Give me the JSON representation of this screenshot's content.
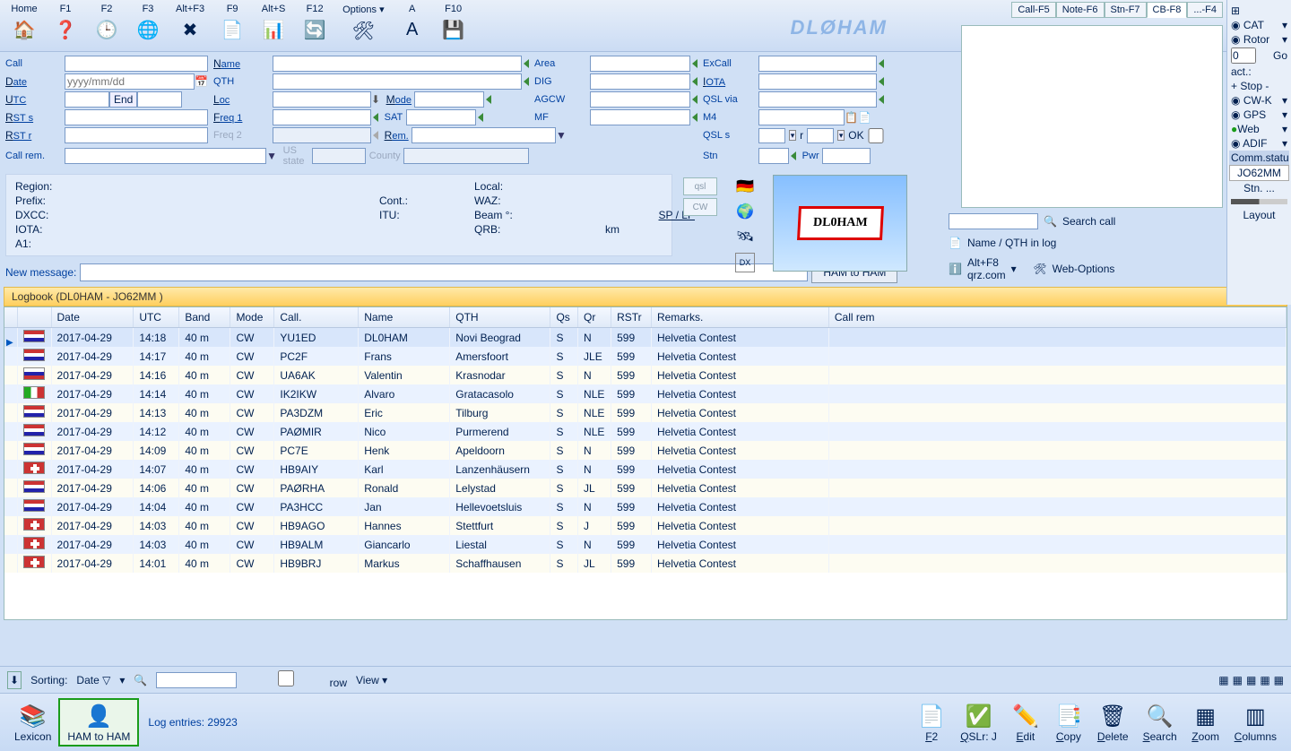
{
  "toolbar": {
    "items": [
      {
        "key": "Home",
        "ico": "🏠"
      },
      {
        "key": "F1",
        "ico": "❓"
      },
      {
        "key": "F2",
        "ico": "🕒"
      },
      {
        "key": "F3",
        "ico": "🌐"
      },
      {
        "key": "Alt+F3",
        "ico": "✖"
      },
      {
        "key": "F9",
        "ico": "📄"
      },
      {
        "key": "Alt+S",
        "ico": "📊"
      },
      {
        "key": "F12",
        "ico": "🔄"
      },
      {
        "key": "Options ▾",
        "ico": "🛠"
      },
      {
        "key": "A",
        "ico": "A"
      },
      {
        "key": "F10",
        "ico": "💾"
      }
    ],
    "brand": "DLØHAM"
  },
  "tabs": [
    "Call-F5",
    "Note-F6",
    "Stn-F7",
    "CB-F8",
    "...-F4"
  ],
  "side": {
    "cat": "CAT",
    "rotor": "Rotor",
    "go": "Go",
    "go_val": "0",
    "act": "act.:",
    "stop": "Stop",
    "cwk": "CW-K",
    "gps": "GPS",
    "web": "Web",
    "adif": "ADIF",
    "comm": "Comm.statu",
    "loc": "JO62MM",
    "stn": "Stn. ...",
    "layout": "Layout"
  },
  "form": {
    "call": "Call",
    "date": "Date",
    "date_ph": "yyyy/mm/dd",
    "utc": "UTC",
    "end": "End",
    "rsts": "RST s",
    "rstr": "RST r",
    "name": "Name",
    "qth": "QTH",
    "loc": "Loc",
    "mode": "Mode",
    "freq1": "Freq 1",
    "freq2": "Freq 2",
    "sat": "SAT",
    "rem": "Rem.",
    "area": "Area",
    "dig": "DIG",
    "agcw": "AGCW",
    "mf": "MF",
    "excall": "ExCall",
    "iota": "IOTA",
    "qslvia": "QSL via",
    "m4": "M4",
    "qsls": "QSL s",
    "r": "r",
    "ok": "OK",
    "stn2": "Stn",
    "pwr": "Pwr",
    "callrem": "Call rem.",
    "usstate": "US state",
    "county": "County"
  },
  "region": {
    "region": "Region:",
    "prefix": "Prefix:",
    "dxcc": "DXCC:",
    "iota": "IOTA:",
    "a1": "A1:",
    "cont": "Cont.:",
    "itu": "ITU:",
    "local": "Local:",
    "waz": "WAZ:",
    "beam": "Beam °:",
    "qrb": "QRB:",
    "km": "km",
    "splp": "SP / LP"
  },
  "mini": {
    "qsl": "qsl",
    "cw": "CW"
  },
  "flag_text": "DL0HAM",
  "search": {
    "label": "Search call",
    "nameqth": "Name / QTH in log",
    "altf8": "Alt+F8",
    "qrz": "qrz.com",
    "webopt": "Web-Options"
  },
  "newmsg": {
    "label": "New message:",
    "btn": "HAM to HAM"
  },
  "logbook_title": "Logbook  (DL0HAM - JO62MM )",
  "cols": [
    "",
    "",
    "Date",
    "UTC",
    "Band",
    "Mode",
    "Call.",
    "Name",
    "QTH",
    "Qs",
    "Qr",
    "RSTr",
    "Remarks.",
    "Call rem"
  ],
  "rows": [
    {
      "flag": "nl",
      "date": "2017-04-29",
      "utc": "14:18",
      "band": "40 m",
      "mode": "CW",
      "call": "YU1ED",
      "name": "DL0HAM",
      "qth": "Novi Beograd",
      "qs": "S",
      "qr": "N",
      "rstr": "599",
      "rem": "Helvetia Contest",
      "sel": true,
      "ptr": true
    },
    {
      "flag": "nl",
      "date": "2017-04-29",
      "utc": "14:17",
      "band": "40 m",
      "mode": "CW",
      "call": "PC2F",
      "name": "Frans",
      "qth": "Amersfoort",
      "qs": "S",
      "qr": "JLE",
      "rstr": "599",
      "rem": "Helvetia Contest"
    },
    {
      "flag": "ru",
      "date": "2017-04-29",
      "utc": "14:16",
      "band": "40 m",
      "mode": "CW",
      "call": "UA6AK",
      "name": "Valentin",
      "qth": "Krasnodar",
      "qs": "S",
      "qr": "N",
      "rstr": "599",
      "rem": "Helvetia Contest"
    },
    {
      "flag": "it",
      "date": "2017-04-29",
      "utc": "14:14",
      "band": "40 m",
      "mode": "CW",
      "call": "IK2IKW",
      "name": "Alvaro",
      "qth": "Gratacasolo",
      "qs": "S",
      "qr": "NLE",
      "rstr": "599",
      "rem": "Helvetia Contest"
    },
    {
      "flag": "nl",
      "date": "2017-04-29",
      "utc": "14:13",
      "band": "40 m",
      "mode": "CW",
      "call": "PA3DZM",
      "name": "Eric",
      "qth": "Tilburg",
      "qs": "S",
      "qr": "NLE",
      "rstr": "599",
      "rem": "Helvetia Contest"
    },
    {
      "flag": "nl",
      "date": "2017-04-29",
      "utc": "14:12",
      "band": "40 m",
      "mode": "CW",
      "call": "PAØMIR",
      "name": "Nico",
      "qth": "Purmerend",
      "qs": "S",
      "qr": "NLE",
      "rstr": "599",
      "rem": "Helvetia Contest"
    },
    {
      "flag": "nl",
      "date": "2017-04-29",
      "utc": "14:09",
      "band": "40 m",
      "mode": "CW",
      "call": "PC7E",
      "name": "Henk",
      "qth": "Apeldoorn",
      "qs": "S",
      "qr": "N",
      "rstr": "599",
      "rem": "Helvetia Contest"
    },
    {
      "flag": "ch",
      "date": "2017-04-29",
      "utc": "14:07",
      "band": "40 m",
      "mode": "CW",
      "call": "HB9AIY",
      "name": "Karl",
      "qth": "Lanzenhäusern",
      "qs": "S",
      "qr": "N",
      "rstr": "599",
      "rem": "Helvetia Contest"
    },
    {
      "flag": "nl",
      "date": "2017-04-29",
      "utc": "14:06",
      "band": "40 m",
      "mode": "CW",
      "call": "PAØRHA",
      "name": "Ronald",
      "qth": "Lelystad",
      "qs": "S",
      "qr": "JL",
      "rstr": "599",
      "rem": "Helvetia Contest"
    },
    {
      "flag": "nl",
      "date": "2017-04-29",
      "utc": "14:04",
      "band": "40 m",
      "mode": "CW",
      "call": "PA3HCC",
      "name": "Jan",
      "qth": "Hellevoetsluis",
      "qs": "S",
      "qr": "N",
      "rstr": "599",
      "rem": "Helvetia Contest"
    },
    {
      "flag": "ch",
      "date": "2017-04-29",
      "utc": "14:03",
      "band": "40 m",
      "mode": "CW",
      "call": "HB9AGO",
      "name": "Hannes",
      "qth": "Stettfurt",
      "qs": "S",
      "qr": "J",
      "rstr": "599",
      "rem": "Helvetia Contest"
    },
    {
      "flag": "ch",
      "date": "2017-04-29",
      "utc": "14:03",
      "band": "40 m",
      "mode": "CW",
      "call": "HB9ALM",
      "name": "Giancarlo",
      "qth": "Liestal",
      "qs": "S",
      "qr": "N",
      "rstr": "599",
      "rem": "Helvetia Contest"
    },
    {
      "flag": "ch",
      "date": "2017-04-29",
      "utc": "14:01",
      "band": "40 m",
      "mode": "CW",
      "call": "HB9BRJ",
      "name": "Markus",
      "qth": "Schaffhausen",
      "qs": "S",
      "qr": "JL",
      "rstr": "599",
      "rem": "Helvetia Contest"
    }
  ],
  "sortbar": {
    "sorting": "Sorting:",
    "date": "Date ▽",
    "row": "row",
    "view": "View"
  },
  "bottom": {
    "lexicon": "Lexicon",
    "ham": "HAM to HAM",
    "logentries": "Log entries: 29923",
    "btns": [
      {
        "l": "F2",
        "i": "📄"
      },
      {
        "l": "QSLr: J",
        "i": "✅"
      },
      {
        "l": "Edit",
        "i": "✏️"
      },
      {
        "l": "Copy",
        "i": "📑"
      },
      {
        "l": "Delete",
        "i": "🗑"
      },
      {
        "l": "Search",
        "i": "🔍"
      },
      {
        "l": "Zoom",
        "i": "▦"
      },
      {
        "l": "Columns",
        "i": "▥"
      }
    ]
  }
}
